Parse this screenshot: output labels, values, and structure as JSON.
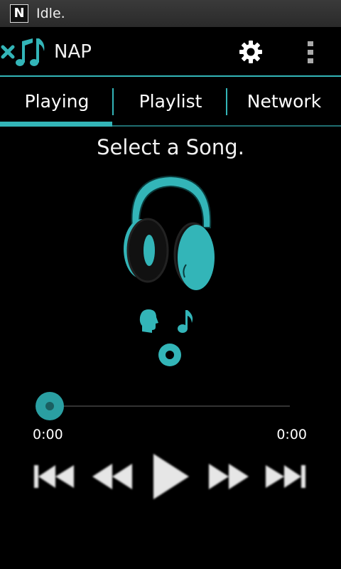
{
  "status_bar": {
    "notification_icon": "n-icon",
    "notification_glyph": "N",
    "status_text": "Idle."
  },
  "action_bar": {
    "logo_icon": "nap-logo-icon",
    "title": "NAP",
    "settings_icon": "gear-icon",
    "overflow_icon": "overflow-menu-icon"
  },
  "tabs": [
    {
      "label": "Playing",
      "active": true
    },
    {
      "label": "Playlist",
      "active": false
    },
    {
      "label": "Network",
      "active": false
    }
  ],
  "now_playing": {
    "title": "Select a Song.",
    "art_icon": "headphones-icon",
    "artist_icon": "artist-icon",
    "song_icon": "music-note-icon",
    "album_icon": "album-icon"
  },
  "seek": {
    "progress": 0,
    "elapsed": "0:00",
    "duration": "0:00"
  },
  "controls": [
    "skip-previous-icon",
    "rewind-icon",
    "play-icon",
    "fast-forward-icon",
    "skip-next-icon"
  ],
  "colors": {
    "accent": "#33b5b8",
    "background": "#000000",
    "status_bar": "#2e2e2e"
  }
}
